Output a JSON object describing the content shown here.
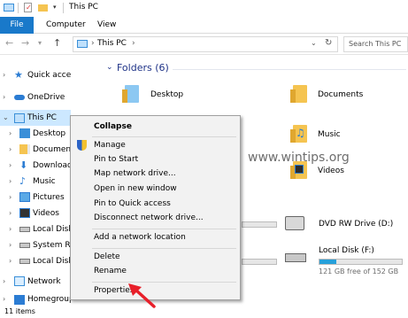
{
  "titlebar": {
    "title": "This PC",
    "qat_icon": "dropdown-chevron"
  },
  "ribbon": {
    "tabs": [
      "File",
      "Computer",
      "View"
    ]
  },
  "navbar": {
    "path": "This PC",
    "search_placeholder": "Search This PC"
  },
  "navpane": {
    "items": [
      {
        "label": "Quick access",
        "icon": "star-icon"
      },
      {
        "label": "OneDrive",
        "icon": "cloud-icon"
      },
      {
        "label": "This PC",
        "icon": "computer-icon"
      },
      {
        "label": "Desktop",
        "icon": "desktop-folder-icon"
      },
      {
        "label": "Documents",
        "icon": "documents-folder-icon"
      },
      {
        "label": "Downloads",
        "icon": "downloads-folder-icon"
      },
      {
        "label": "Music",
        "icon": "music-folder-icon"
      },
      {
        "label": "Pictures",
        "icon": "pictures-folder-icon"
      },
      {
        "label": "Videos",
        "icon": "videos-folder-icon"
      },
      {
        "label": "Local Disk",
        "icon": "disk-icon"
      },
      {
        "label": "System Rese",
        "icon": "disk-icon"
      },
      {
        "label": "Local Disk",
        "icon": "disk-icon"
      },
      {
        "label": "Network",
        "icon": "network-icon"
      },
      {
        "label": "Homegroup",
        "icon": "homegroup-icon"
      }
    ]
  },
  "content": {
    "folders_header": "Folders (6)",
    "folders": [
      "Desktop",
      "Documents",
      "Music",
      "Videos"
    ],
    "drives": [
      {
        "name": "DVD RW Drive (D:)",
        "detail": ""
      },
      {
        "name": "Local Disk (F:)",
        "detail": "121 GB free of 152 GB",
        "used_fraction": 0.2
      }
    ],
    "watermark": "www.wintips.org"
  },
  "context_menu": {
    "collapse": "Collapse",
    "manage": "Manage",
    "pin_to_start": "Pin to Start",
    "map_network_drive": "Map network drive...",
    "open_new_window": "Open in new window",
    "pin_quick_access": "Pin to Quick access",
    "disconnect_network_drive": "Disconnect network drive...",
    "add_network_location": "Add a network location",
    "delete": "Delete",
    "rename": "Rename",
    "properties": "Properties"
  },
  "statusbar": {
    "items": "11 items"
  },
  "colors": {
    "accent": "#1979ca",
    "selection": "#cce8ff",
    "arrow": "#e8202a",
    "folder": "#f5c451"
  }
}
